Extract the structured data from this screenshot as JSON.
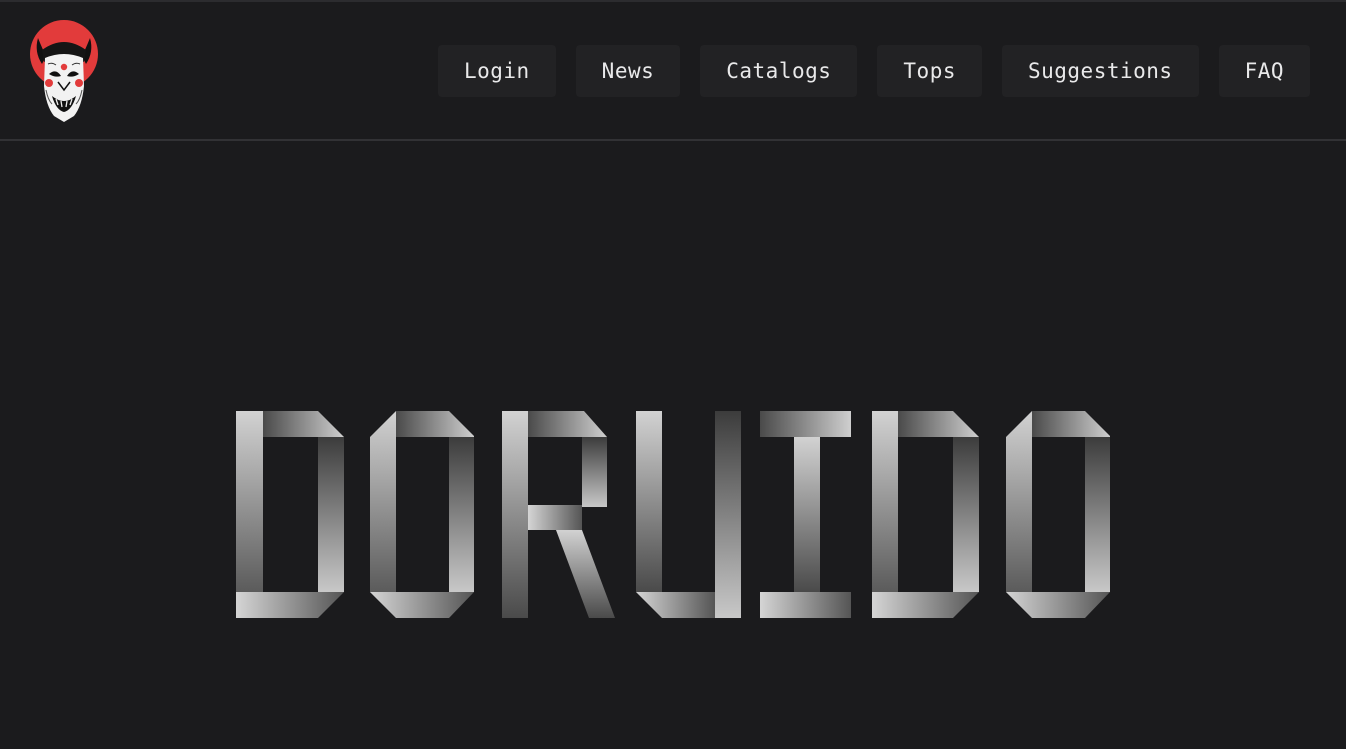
{
  "header": {
    "logo_icon": "oni-mask-logo-icon",
    "nav": [
      {
        "label": "Login",
        "name": "nav-login-button"
      },
      {
        "label": "News",
        "name": "nav-news-button"
      },
      {
        "label": "Catalogs",
        "name": "nav-catalogs-button"
      },
      {
        "label": "Tops",
        "name": "nav-tops-button"
      },
      {
        "label": "Suggestions",
        "name": "nav-suggestions-button"
      },
      {
        "label": "FAQ",
        "name": "nav-faq-button"
      }
    ]
  },
  "hero": {
    "wordmark": "DORUIDO",
    "wordmark_style": "folded-ribbon-letters"
  },
  "colors": {
    "background": "#1b1b1d",
    "nav_button_bg": "#222224",
    "nav_text": "#e9e9ea",
    "logo_red": "#e23b3b"
  }
}
